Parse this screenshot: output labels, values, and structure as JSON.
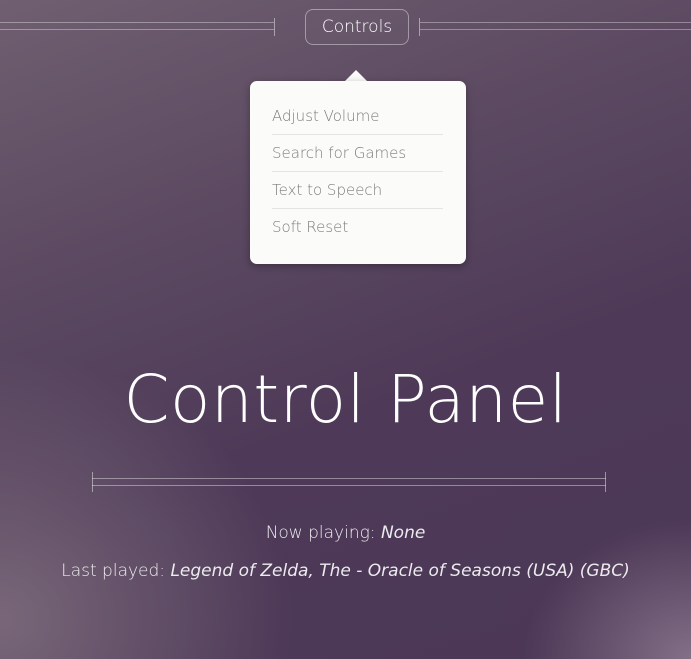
{
  "header": {
    "controls_label": "Controls"
  },
  "menu": {
    "items": [
      {
        "label": "Adjust Volume"
      },
      {
        "label": "Search for Games"
      },
      {
        "label": "Text to Speech"
      },
      {
        "label": "Soft Reset"
      }
    ]
  },
  "main": {
    "title": "Control Panel",
    "now_playing_label": "Now playing:",
    "now_playing_value": "None",
    "last_played_label": "Last played:",
    "last_played_value": "Legend of Zelda, The - Oracle of Seasons (USA) (GBC)"
  }
}
